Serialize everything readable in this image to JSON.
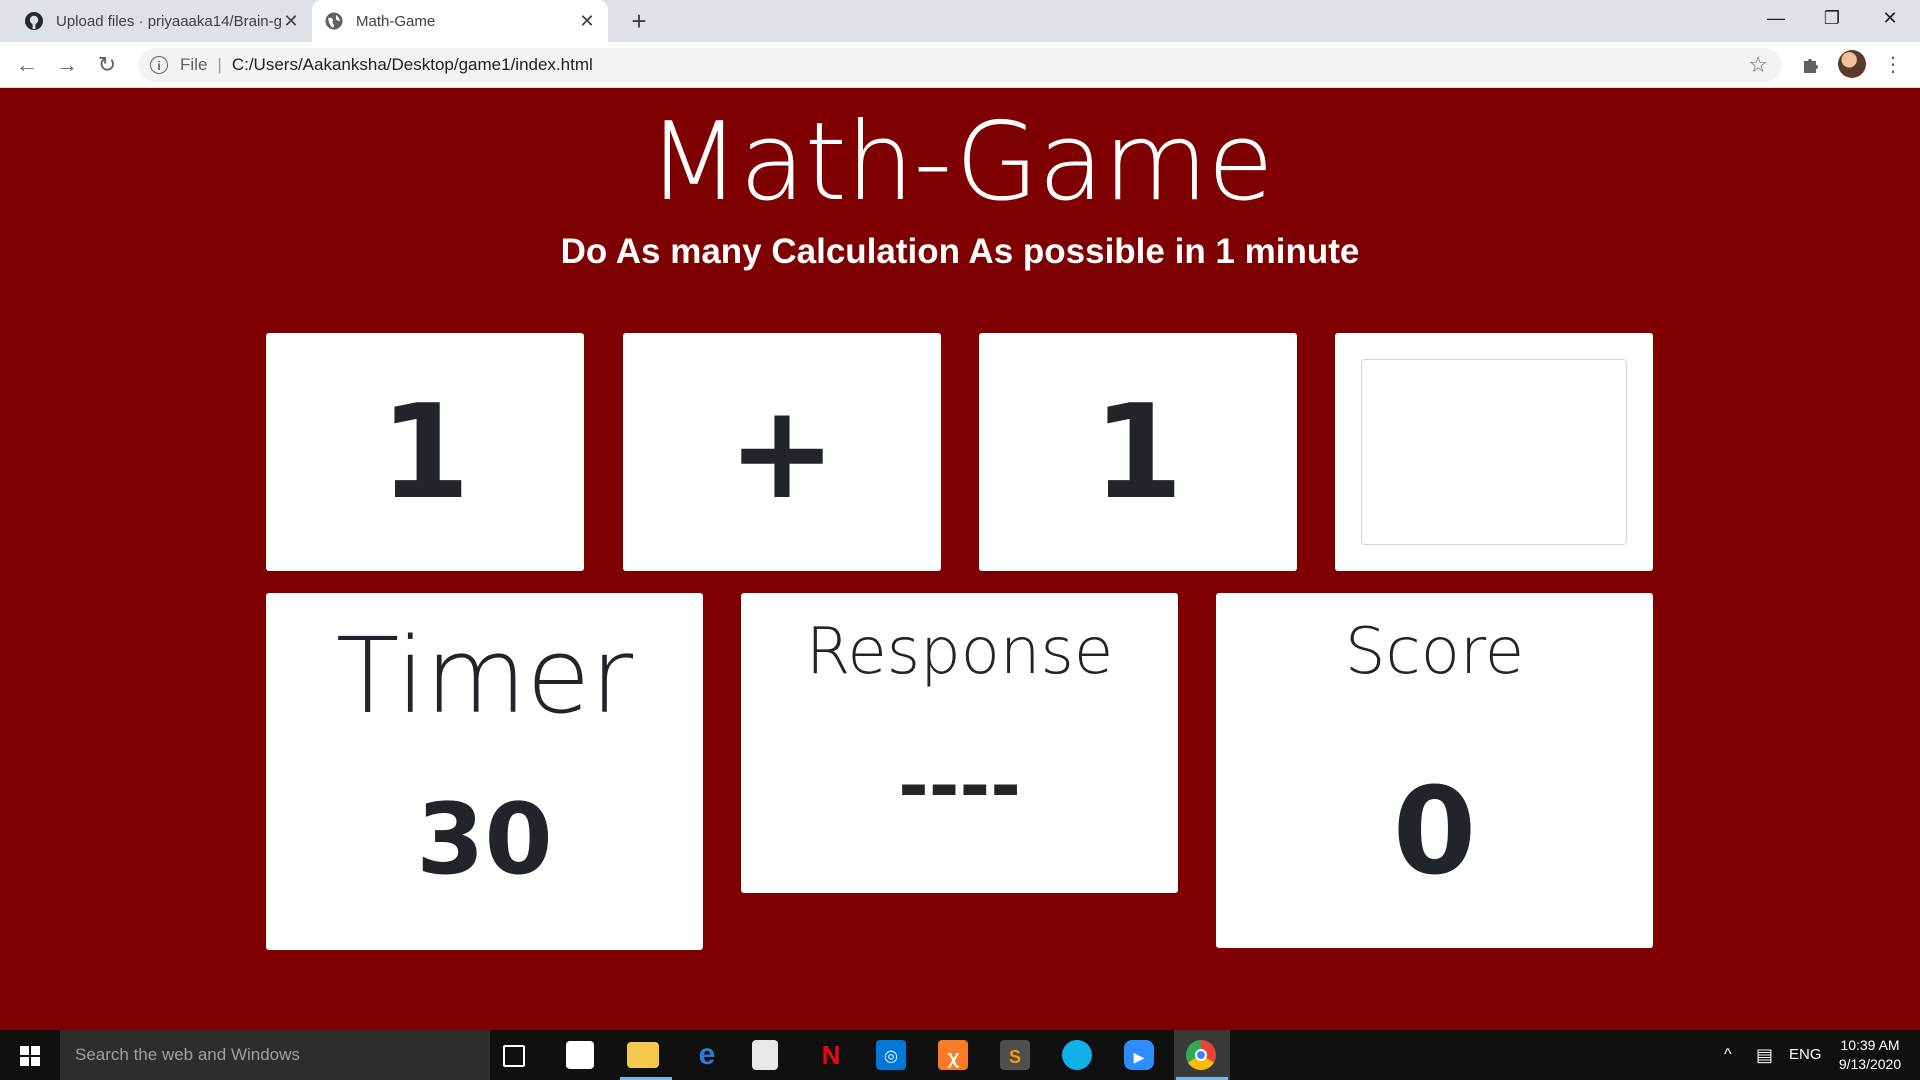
{
  "browser": {
    "tabs": [
      {
        "title": "Upload files · priyaaaka14/Brain-game",
        "icon": "github-icon"
      },
      {
        "title": "Math-Game",
        "icon": "globe-icon"
      }
    ],
    "new_tab_label": "+",
    "address": {
      "scheme": "File",
      "url": "C:/Users/Aakanksha/Desktop/game1/index.html"
    }
  },
  "page": {
    "title": "Math-Game",
    "subtitle": "Do As many Calculation As possible in 1 minute",
    "question": {
      "operand1": "1",
      "operator": "+",
      "operand2": "1",
      "answer_value": ""
    },
    "timer": {
      "label": "Timer",
      "value": "30"
    },
    "response": {
      "label": "Response",
      "value": "----"
    },
    "score": {
      "label": "Score",
      "value": "0"
    }
  },
  "taskbar": {
    "search_placeholder": "Search the web and Windows",
    "language": "ENG",
    "time": "10:39 AM",
    "date": "9/13/2020"
  },
  "colors": {
    "page_background": "#7f0000",
    "card_background": "#ffffff",
    "card_text": "#212529"
  }
}
